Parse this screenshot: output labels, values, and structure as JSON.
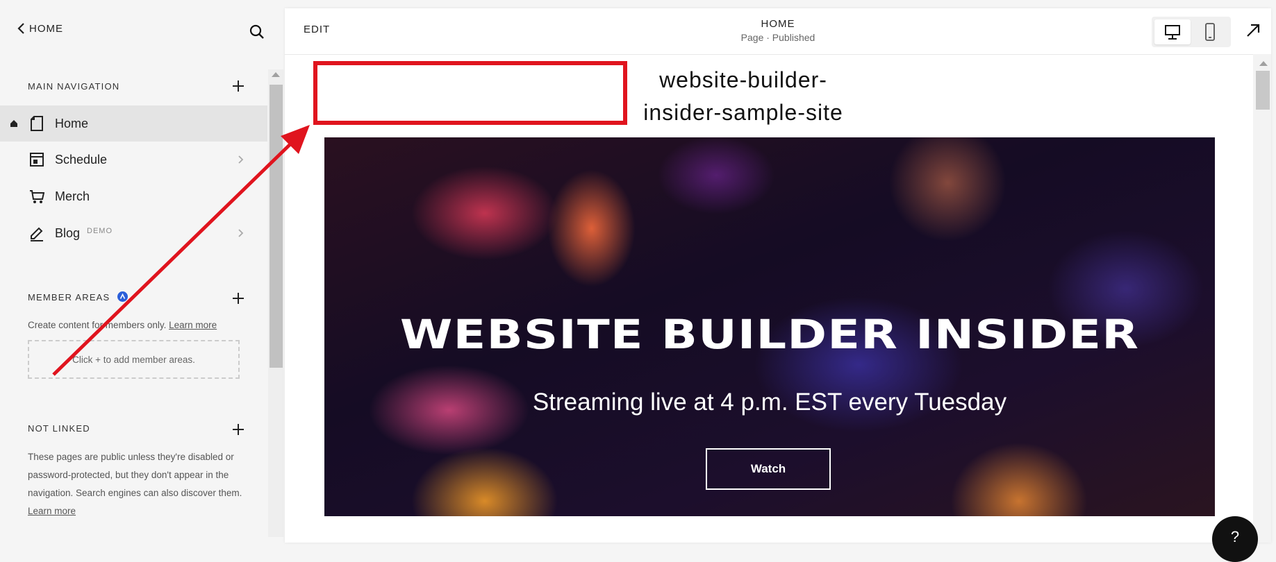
{
  "sidebar": {
    "back_label": "HOME",
    "main_nav_title": "MAIN NAVIGATION",
    "items": [
      {
        "label": "Home"
      },
      {
        "label": "Schedule"
      },
      {
        "label": "Merch"
      },
      {
        "label": "Blog",
        "badge": "DEMO"
      }
    ],
    "member_areas": {
      "title": "MEMBER AREAS",
      "desc": "Create content for members only.",
      "learn_more": "Learn more",
      "empty_text": "Click + to add member areas."
    },
    "not_linked": {
      "title": "NOT LINKED",
      "desc": "These pages are public unless they're disabled or password-protected, but they don't appear in the navigation. Search engines can also discover them.",
      "learn_more": "Learn more"
    }
  },
  "header": {
    "edit_label": "EDIT",
    "page_title": "HOME",
    "page_status": "Page · Published"
  },
  "preview": {
    "site_title": "website-builder-insider-sample-site",
    "hero_title": "WEBSITE BUILDER INSIDER",
    "hero_subtitle": "Streaming live at 4 p.m. EST every Tuesday",
    "watch_label": "Watch"
  },
  "colors": {
    "annotation_red": "#e0141e",
    "member_badge": "#2b5fd9",
    "active_nav_bg": "#e4e4e4"
  },
  "icons": {
    "back": "chevron-left-icon",
    "search": "search-icon",
    "add": "plus-icon",
    "home_indicator": "home-icon",
    "page": "page-icon",
    "schedule": "calendar-icon",
    "merch": "cart-icon",
    "blog": "blog-icon",
    "member": "member-areas-icon",
    "desktop": "desktop-icon",
    "mobile": "mobile-icon",
    "open_external": "open-external-icon",
    "help": "help-icon"
  }
}
